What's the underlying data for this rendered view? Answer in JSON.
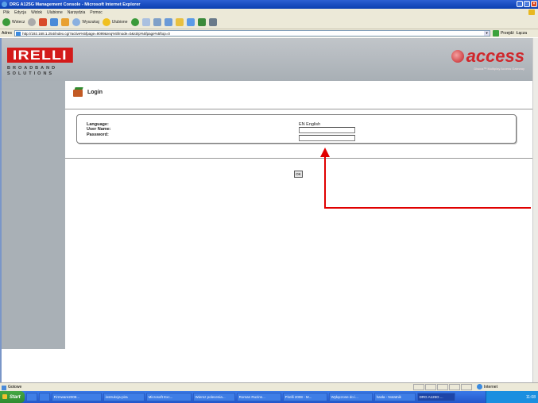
{
  "window": {
    "title": "DRG A125G Management Console - Microsoft Internet Explorer"
  },
  "menu": [
    "Plik",
    "Edycja",
    "Widok",
    "Ulubione",
    "Narzędzia",
    "Pomoc"
  ],
  "toolbar": {
    "back_label": "Wstecz",
    "search_label": "Wyszukaj",
    "favorites_label": "Ulubione"
  },
  "address": {
    "label": "Adres",
    "url": "http://192.168.1.254/index.cgi?active%5fpage=9099&req%5fmode=0&strip%5fpage%5ftop=0",
    "go_label": "Przejdź",
    "links_label": "Łącza"
  },
  "header": {
    "pirelli_logo": "IRELLI",
    "pirelli_sub": "BROADBAND SOLUTIONS",
    "access_logo": "access",
    "access_sub": "Discus™ Multiplay Access Gateway"
  },
  "login": {
    "title": "Login",
    "language_label": "Language:",
    "language_value": "EN English",
    "username_label": "User Name:",
    "password_label": "Password:",
    "username_value": "",
    "password_value": "",
    "ok_label": "OK"
  },
  "status": {
    "left": "Gotowe",
    "zone": "Internet"
  },
  "taskbar": {
    "start": "Start",
    "buttons": [
      {
        "label": "Firmware2008...",
        "active": false
      },
      {
        "label": "instrukcja-pira",
        "active": false
      },
      {
        "label": "Microsoft Exc...",
        "active": false
      },
      {
        "label": "Wiersz polecenia...",
        "active": false
      },
      {
        "label": "Roman Ruzins...",
        "active": false
      },
      {
        "label": "Pirelli 2008 - M...",
        "active": false
      },
      {
        "label": "Wyłączone do i...",
        "active": false
      },
      {
        "label": "hasła - Notatnik",
        "active": false
      },
      {
        "label": "DRG A125G ...",
        "active": true
      }
    ],
    "clock": "11:08"
  },
  "colors": {
    "brand_red": "#d31a1a",
    "header_gray": "#a9b0b6",
    "annotation_arrow": "#e00000"
  }
}
